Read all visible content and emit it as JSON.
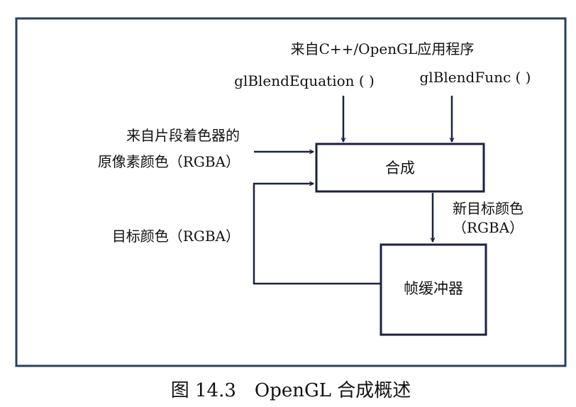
{
  "colors": {
    "frame": "#2b3f5c",
    "line": "#1a2144",
    "text": "#111111",
    "background": "#ffffff"
  },
  "diagram": {
    "top_source": "来自C++/OpenGL应用程序",
    "equation_label": "glBlendEquation ( )",
    "func_label": "glBlendFunc ( )",
    "source_color_line1": "来自片段着色器的",
    "source_color_line2": "原像素颜色（RGBA）",
    "dest_color_label": "目标颜色（RGBA）",
    "blend_box": "合成",
    "new_color_line1": "新目标颜色",
    "new_color_line2": "（RGBA）",
    "framebuffer_box": "帧缓冲器"
  },
  "caption": "图 14.3　OpenGL 合成概述"
}
